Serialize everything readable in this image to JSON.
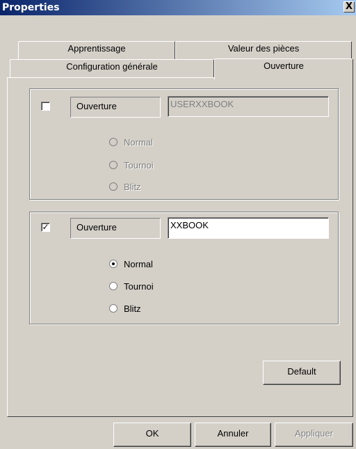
{
  "window": {
    "title": "Properties",
    "close_glyph": "X"
  },
  "tabs": {
    "apprentissage": "Apprentissage",
    "valeur": "Valeur des pièces",
    "config": "Configuration générale",
    "ouverture": "Ouverture"
  },
  "group1": {
    "checked": false,
    "label": "Ouverture",
    "value": "USERXXBOOK",
    "radios": [
      "Normal",
      "Tournoi",
      "Blitz"
    ],
    "selected": null,
    "enabled": false
  },
  "group2": {
    "checked": true,
    "check_glyph": "✓",
    "label": "Ouverture",
    "value": "XXBOOK",
    "radios": [
      "Normal",
      "Tournoi",
      "Blitz"
    ],
    "selected": "Normal",
    "enabled": true
  },
  "buttons": {
    "default": "Default",
    "ok": "OK",
    "cancel": "Annuler",
    "apply": "Appliquer"
  }
}
